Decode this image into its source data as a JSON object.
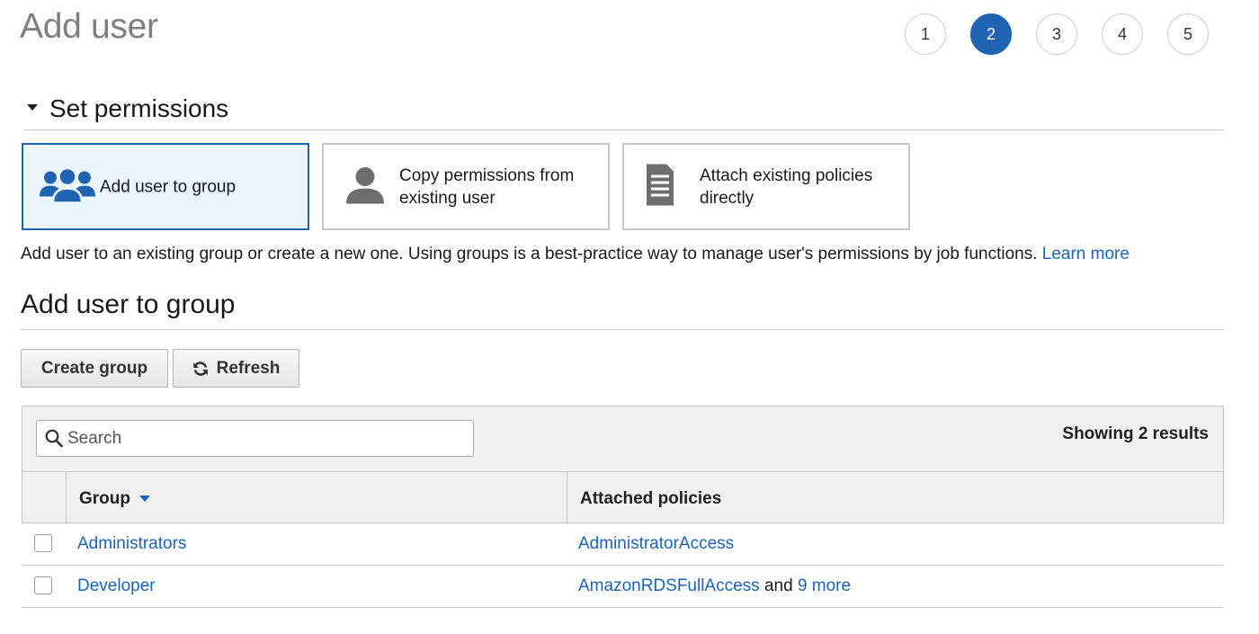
{
  "page": {
    "title": "Add user"
  },
  "steps": [
    {
      "label": "1",
      "active": false
    },
    {
      "label": "2",
      "active": true
    },
    {
      "label": "3",
      "active": false
    },
    {
      "label": "4",
      "active": false
    },
    {
      "label": "5",
      "active": false
    }
  ],
  "permissions": {
    "section_title": "Set permissions",
    "options": [
      {
        "line1": "Add user to group",
        "line2": "",
        "icon": "users-group-icon",
        "selected": true
      },
      {
        "line1": "Copy permissions from",
        "line2": "existing user",
        "icon": "user-icon",
        "selected": false
      },
      {
        "line1": "Attach existing policies",
        "line2": "directly",
        "icon": "document-icon",
        "selected": false
      }
    ],
    "description": "Add user to an existing group or create a new one. Using groups is a best-practice way to manage user's permissions by job functions.",
    "learn_more": "Learn more"
  },
  "group_section": {
    "title": "Add user to group",
    "create_label": "Create group",
    "refresh_label": "Refresh",
    "search_placeholder": "Search",
    "showing": "Showing 2 results",
    "columns": {
      "group": "Group",
      "policies": "Attached policies"
    },
    "rows": [
      {
        "group": "Administrators",
        "policy": "AdministratorAccess",
        "connector": "",
        "more": "",
        "checked": false
      },
      {
        "group": "Developer",
        "policy": "AmazonRDSFullAccess",
        "connector": "and",
        "more": "9 more",
        "checked": false
      }
    ]
  },
  "colors": {
    "accent": "#1f63b3",
    "link": "#1a64b6",
    "selected_card_bg": "#eaf5fe"
  }
}
